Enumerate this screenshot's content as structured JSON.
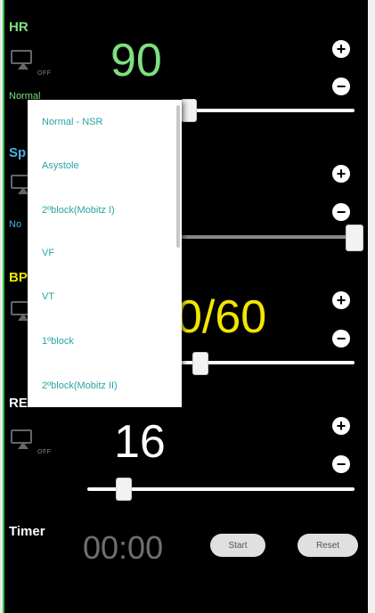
{
  "hr": {
    "label": "HR",
    "off": "OFF",
    "mode": "Normal",
    "value": "90",
    "plus": "+",
    "minus": "−"
  },
  "spo2": {
    "label": "Sp",
    "mode": "No",
    "plus": "+",
    "minus": "−"
  },
  "bp": {
    "label": "BP",
    "value": "0/60",
    "plus": "+",
    "minus": "−"
  },
  "resp": {
    "label": "RE",
    "off": "OFF",
    "value": "16",
    "plus": "+",
    "minus": "−"
  },
  "timer": {
    "label": "Timer",
    "value": "00:00",
    "start": "Start",
    "reset": "Reset"
  },
  "rhythm_dropdown": {
    "options": [
      "Normal - NSR",
      "Asystole",
      "2ºblock(Mobitz I)",
      "VF",
      "VT",
      "1ºblock",
      "2ºblock(Mobitz II)"
    ]
  },
  "colors": {
    "hr": "#7ee07e",
    "bp": "#f2e600",
    "resp": "#ffffff",
    "timer": "#6f6f6f",
    "dropdown_text": "#29a3a3"
  }
}
